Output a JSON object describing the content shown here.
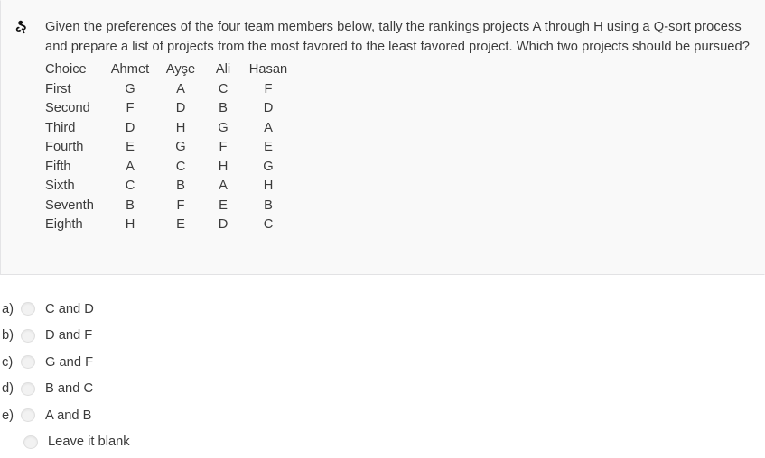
{
  "question": {
    "icon": "pin-glyph-icon",
    "text": "Given the preferences of the four team members below, tally the rankings projects A through H using a Q-sort process and prepare a list of projects from the most favored to the least favored project. Which two projects should be pursued?",
    "table": {
      "headers": [
        "Choice",
        "Ahmet",
        "Ayşe",
        "Ali",
        "Hasan"
      ],
      "rows": [
        {
          "choice": "First",
          "ahmet": "G",
          "ayse": "A",
          "ali": "C",
          "hasan": "F"
        },
        {
          "choice": "Second",
          "ahmet": "F",
          "ayse": "D",
          "ali": "B",
          "hasan": "D"
        },
        {
          "choice": "Third",
          "ahmet": "D",
          "ayse": "H",
          "ali": "G",
          "hasan": "A"
        },
        {
          "choice": "Fourth",
          "ahmet": "E",
          "ayse": "G",
          "ali": "F",
          "hasan": "E"
        },
        {
          "choice": "Fifth",
          "ahmet": "A",
          "ayse": "C",
          "ali": "H",
          "hasan": "G"
        },
        {
          "choice": "Sixth",
          "ahmet": "C",
          "ayse": "B",
          "ali": "A",
          "hasan": "H"
        },
        {
          "choice": "Seventh",
          "ahmet": "B",
          "ayse": "F",
          "ali": "E",
          "hasan": "B"
        },
        {
          "choice": "Eighth",
          "ahmet": "H",
          "ayse": "E",
          "ali": "D",
          "hasan": "C"
        }
      ]
    }
  },
  "options": [
    {
      "letter": "a)",
      "label": "C and D"
    },
    {
      "letter": "b)",
      "label": "D and F"
    },
    {
      "letter": "c)",
      "label": "G and F"
    },
    {
      "letter": "d)",
      "label": "B and C"
    },
    {
      "letter": "e)",
      "label": "A and B"
    },
    {
      "letter": "",
      "label": "Leave it blank"
    }
  ],
  "colors": {
    "card_background": "#f9f9f9",
    "page_background": "#ffffff",
    "text": "#3b3b3b",
    "radio_fill": "#f2f2f2",
    "radio_border": "#dedede",
    "card_border": "#e4e4e6"
  }
}
